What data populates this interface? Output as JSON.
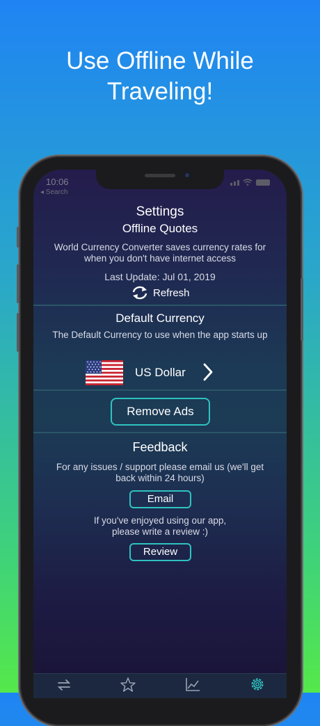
{
  "headline": {
    "line1": "Use Offline While",
    "line2": "Traveling!"
  },
  "status_bar": {
    "time": "10:06",
    "back_label": "◂ Search"
  },
  "settings": {
    "title": "Settings",
    "offline": {
      "heading": "Offline Quotes",
      "description": "World Currency Converter saves currency rates for when you don't have internet access",
      "last_update": "Last Update: Jul 01, 2019",
      "refresh_label": "Refresh"
    },
    "default_currency": {
      "heading": "Default Currency",
      "description": "The Default Currency to use when the app starts up",
      "selected_currency": "US Dollar",
      "flag_icon": "us-flag-icon"
    },
    "remove_ads_label": "Remove Ads",
    "feedback": {
      "heading": "Feedback",
      "support_text": "For any issues / support please email us (we'll get back within 24 hours)",
      "email_label": "Email",
      "review_text": "If you've enjoyed using our app, please write a review :)",
      "review_label": "Review"
    }
  },
  "tab_bar": {
    "tabs": [
      {
        "icon": "convert-arrows-icon"
      },
      {
        "icon": "star-icon"
      },
      {
        "icon": "chart-icon"
      },
      {
        "icon": "gear-icon",
        "active": true
      }
    ]
  },
  "colors": {
    "accent": "#2fc3c0",
    "background_top": "#1f84f3",
    "background_bottom": "#55e84a",
    "divider": "#2b5669"
  }
}
